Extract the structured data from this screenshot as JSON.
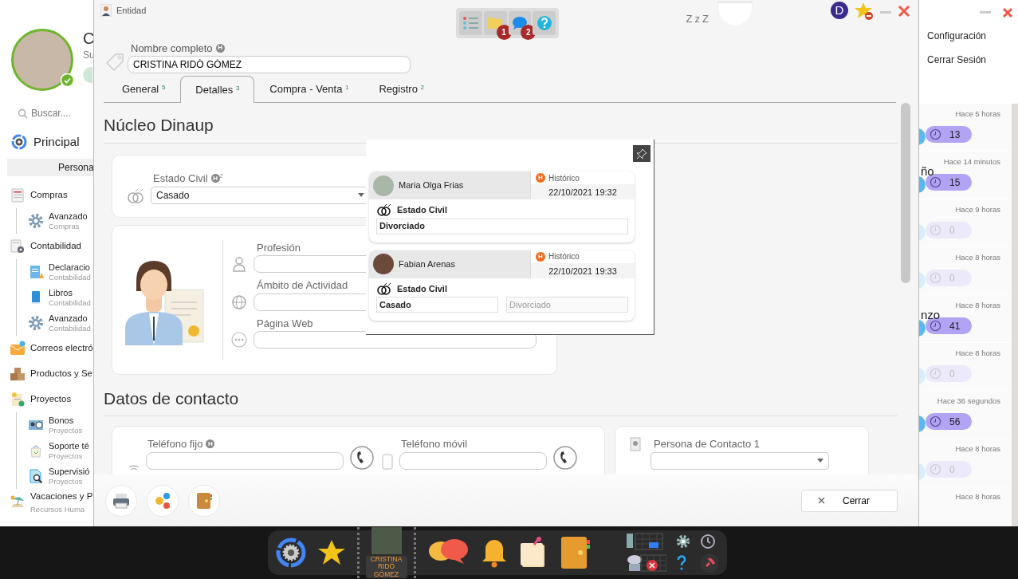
{
  "sidebar": {
    "user_name": "C",
    "user_subtitle": "Su",
    "search": {
      "placeholder": "Buscar...."
    },
    "section": "Principal",
    "subsection": "Persona",
    "menu": [
      {
        "label": "Compras",
        "children": [
          {
            "label": "Avanzado",
            "sub": "Compras"
          }
        ]
      },
      {
        "label": "Contabilidad",
        "children": [
          {
            "label": "Declaracio",
            "sub": "Contabilidad"
          },
          {
            "label": "Libros",
            "sub": "Contabilidad"
          },
          {
            "label": "Avanzado",
            "sub": "Contabilidad"
          }
        ]
      },
      {
        "label": "Correos electró"
      },
      {
        "label": "Productos y Se"
      },
      {
        "label": "Proyectos",
        "children": [
          {
            "label": "Bonos",
            "sub": "Proyectos"
          },
          {
            "label": "Soporte té",
            "sub": "Proyectos"
          },
          {
            "label": "Supervisió",
            "sub": "Proyectos"
          }
        ]
      },
      {
        "label": "Vacaciones y P",
        "sub": "Recursos Huma"
      }
    ]
  },
  "dialog": {
    "title": "Entidad",
    "toolbar": [
      {
        "kind": "list"
      },
      {
        "kind": "folder",
        "badge": "1"
      },
      {
        "kind": "chat",
        "badge": "2"
      },
      {
        "kind": "help"
      }
    ],
    "sleep_text": "ZzZ",
    "user_initial": "D",
    "name_field": {
      "label": "Nombre completo",
      "mark": "H",
      "value": "CRISTINA RIDÓ GÓMEZ"
    },
    "tabs": [
      {
        "label": "General",
        "count": "5",
        "selected": false
      },
      {
        "label": "Detalles",
        "count": "3",
        "selected": true
      },
      {
        "label": "Compra - Venta",
        "count": "1",
        "selected": false
      },
      {
        "label": "Registro",
        "count": "2",
        "selected": false
      }
    ],
    "nucleo": {
      "title": "Núcleo Dinaup",
      "estado_civil": {
        "label": "Estado Civil",
        "mark": "H",
        "mark_count": "2",
        "value": "Casado"
      },
      "fields": [
        {
          "label": "Profesión"
        },
        {
          "label": "Ámbito de Actividad"
        },
        {
          "label": "Página Web"
        }
      ]
    },
    "contacto": {
      "title": "Datos de contacto",
      "fields": [
        {
          "label": "Teléfono fijo",
          "mark": "H"
        },
        {
          "label": "Teléfono móvil"
        }
      ],
      "contact_person": {
        "label": "Persona de Contacto 1"
      }
    },
    "footer": {
      "close_button": "Cerrar"
    },
    "history_popup": {
      "entries": [
        {
          "user": "Maria Olga Frias",
          "mark": "H",
          "tag": "Histórico",
          "date": "22/10/2021 19:32",
          "field": "Estado Civil",
          "values": [
            {
              "text": "Divorciado",
              "previous": false
            }
          ]
        },
        {
          "user": "Fabian Arenas",
          "mark": "H",
          "tag": "Histórico",
          "date": "22/10/2021 19:33",
          "field": "Estado Civil",
          "values": [
            {
              "text": "Casado",
              "previous": false
            },
            {
              "text": "Divorciado",
              "previous": true
            }
          ]
        }
      ]
    }
  },
  "right_panel": {
    "menu": [
      "Configuración",
      "Cerrar Sesión"
    ],
    "items": [
      {
        "time": "Hace 5 horas",
        "count": "13",
        "active": true
      },
      {
        "name_tail": "ño",
        "time": "Hace 14 minutos",
        "count": "15",
        "active": true
      },
      {
        "time": "Hace 9 horas",
        "count": "0",
        "active": false
      },
      {
        "time": "Hace 8 horas",
        "count": "0",
        "active": false
      },
      {
        "name_tail": "nzo",
        "time": "Hace 8 horas",
        "count": "41",
        "active": true
      },
      {
        "time": "Hace 8 horas",
        "count": "0",
        "active": false
      },
      {
        "time": "Hace 36 segundos",
        "count": "56",
        "active": true
      },
      {
        "time": "Hace 8 horas",
        "count": "0",
        "active": false
      },
      {
        "time": "Hace 8 horas"
      }
    ]
  },
  "taskbar": {
    "thumbnail_label": "CRISTINA RIDÓ GÓMEZ"
  }
}
